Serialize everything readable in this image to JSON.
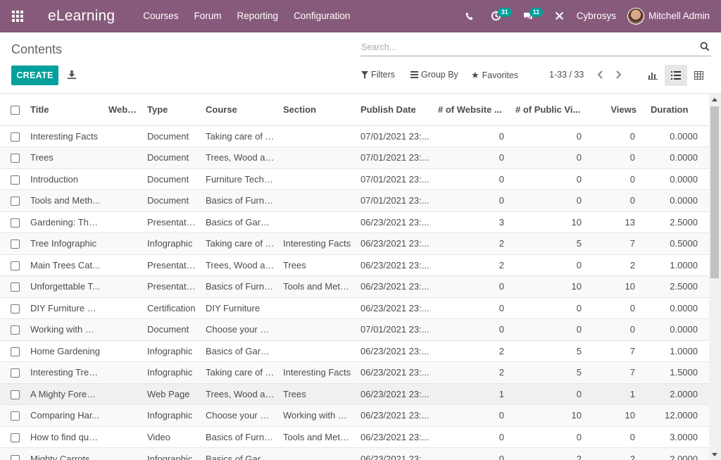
{
  "navbar": {
    "brand": "eLearning",
    "menu": [
      "Courses",
      "Forum",
      "Reporting",
      "Configuration"
    ],
    "activities_count": "31",
    "messages_count": "11",
    "company": "Cybrosys",
    "user": "Mitchell Admin"
  },
  "control_panel": {
    "title": "Contents",
    "search_placeholder": "Search...",
    "create_label": "CREATE",
    "filters_label": "Filters",
    "groupby_label": "Group By",
    "favorites_label": "Favorites",
    "pager": "1-33 / 33"
  },
  "table": {
    "columns": [
      "Title",
      "Website",
      "Type",
      "Course",
      "Section",
      "Publish Date",
      "# of Website ...",
      "# of Public Vi...",
      "Views",
      "Duration"
    ],
    "rows": [
      [
        "Interesting Facts",
        "",
        "Document",
        "Taking care of T...",
        "",
        "07/01/2021 23:...",
        "0",
        "0",
        "0",
        "0.0000"
      ],
      [
        "Trees",
        "",
        "Document",
        "Trees, Wood an...",
        "",
        "07/01/2021 23:...",
        "0",
        "0",
        "0",
        "0.0000"
      ],
      [
        "Introduction",
        "",
        "Document",
        "Furniture Techni...",
        "",
        "07/01/2021 23:...",
        "0",
        "0",
        "0",
        "0.0000"
      ],
      [
        "Tools and Meth...",
        "",
        "Document",
        "Basics of Furnit...",
        "",
        "07/01/2021 23:...",
        "0",
        "0",
        "0",
        "0.0000"
      ],
      [
        "Gardening: The ...",
        "",
        "Presentation",
        "Basics of Garde...",
        "",
        "06/23/2021 23:...",
        "3",
        "10",
        "13",
        "2.5000"
      ],
      [
        "Tree Infographic",
        "",
        "Infographic",
        "Taking care of T...",
        "Interesting Facts",
        "06/23/2021 23:...",
        "2",
        "5",
        "7",
        "0.5000"
      ],
      [
        "Main Trees Cat...",
        "",
        "Presentation",
        "Trees, Wood an...",
        "Trees",
        "06/23/2021 23:...",
        "2",
        "0",
        "2",
        "1.0000"
      ],
      [
        "Unforgettable T...",
        "",
        "Presentation",
        "Basics of Furnit...",
        "Tools and Meth...",
        "06/23/2021 23:...",
        "0",
        "10",
        "10",
        "2.5000"
      ],
      [
        "DIY Furniture Ce...",
        "",
        "Certification",
        "DIY Furniture",
        "",
        "06/23/2021 23:...",
        "0",
        "0",
        "0",
        "0.0000"
      ],
      [
        "Working with W...",
        "",
        "Document",
        "Choose your wo...",
        "",
        "07/01/2021 23:...",
        "0",
        "0",
        "0",
        "0.0000"
      ],
      [
        "Home Gardening",
        "",
        "Infographic",
        "Basics of Garde...",
        "",
        "06/23/2021 23:...",
        "2",
        "5",
        "7",
        "1.0000"
      ],
      [
        "Interesting Tree ...",
        "",
        "Infographic",
        "Taking care of T...",
        "Interesting Facts",
        "06/23/2021 23:...",
        "2",
        "5",
        "7",
        "1.5000"
      ],
      [
        "A Mighty Forest...",
        "",
        "Web Page",
        "Trees, Wood an...",
        "Trees",
        "06/23/2021 23:...",
        "1",
        "0",
        "1",
        "2.0000"
      ],
      [
        "Comparing Har...",
        "",
        "Infographic",
        "Choose your wo...",
        "Working with W...",
        "06/23/2021 23:...",
        "0",
        "10",
        "10",
        "12.0000"
      ],
      [
        "How to find qua...",
        "",
        "Video",
        "Basics of Furnit...",
        "Tools and Meth...",
        "06/23/2021 23:...",
        "0",
        "0",
        "0",
        "3.0000"
      ],
      [
        "Mighty Carrots",
        "",
        "Infographic",
        "Basics of Garde...",
        "",
        "06/23/2021 23:...",
        "0",
        "2",
        "2",
        "2.0000"
      ]
    ]
  }
}
